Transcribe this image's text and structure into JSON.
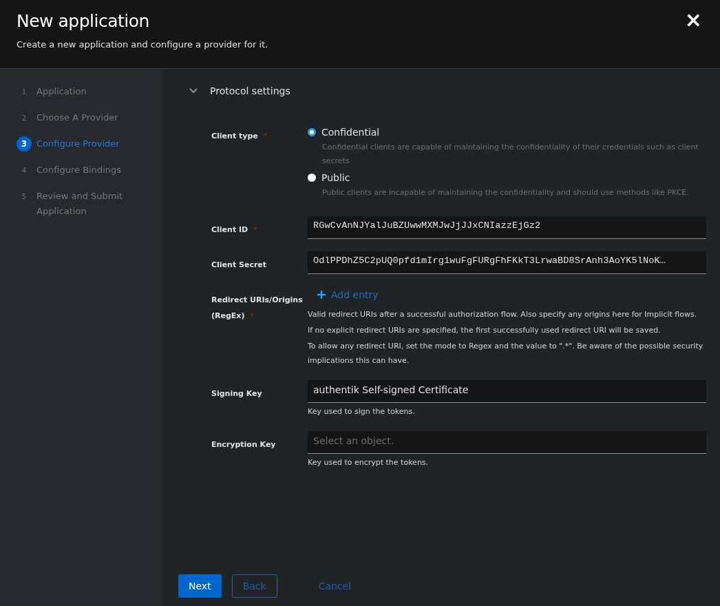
{
  "header": {
    "title": "New application",
    "subtitle": "Create a new application and configure a provider for it.",
    "close": "×"
  },
  "steps": [
    {
      "number": "1",
      "label": "Application",
      "selected": false
    },
    {
      "number": "2",
      "label": "Choose A Provider",
      "selected": false
    },
    {
      "number": "3",
      "label": "Configure Provider",
      "selected": true
    },
    {
      "number": "4",
      "label": "Configure Bindings",
      "selected": false
    },
    {
      "number": "5",
      "label": "Review and Submit Application",
      "selected": false
    }
  ],
  "section": {
    "title": "Protocol settings",
    "expanded": true
  },
  "client_type": {
    "label": "Client type",
    "required_mark": "*",
    "options": [
      {
        "label": "Confidential",
        "description": "Confidential clients are capable of maintaining the confidentiality of their credentials such as client secrets",
        "selected": true
      },
      {
        "label": "Public",
        "description": "Public clients are incapable of maintaining the confidentiality and should use methods like PKCE.",
        "selected": false
      }
    ]
  },
  "fields": [
    {
      "kind": "text",
      "label": "Client ID",
      "required_mark": "*",
      "value": "RGwCvAnNJYalJuBZUwwMXMJwJjJJxCNIazzEjGz2"
    },
    {
      "kind": "text",
      "label": "Client Secret",
      "value": "OdlPPDhZ5C2pUQ0pfd1mIrg1wuFgFURgFhFKkT3LrwaBD8SrAnh3AoYK5lNoK…"
    },
    {
      "kind": "list",
      "label": "Redirect URIs/Origins (RegEx)",
      "required_mark": "*",
      "action": "Add entry",
      "help": [
        "Valid redirect URIs after a successful authorization flow. Also specify any origins here for Implicit flows.",
        "If no explicit redirect URIs are specified, the first successfully used redirect URI will be saved.",
        "To allow any redirect URI, set the mode to Regex and the value to \".*\". Be aware of the possible security implications this can have."
      ]
    },
    {
      "kind": "select",
      "label": "Signing Key",
      "value": "authentik Self-signed Certificate",
      "help": [
        "Key used to sign the tokens."
      ]
    },
    {
      "kind": "select",
      "label": "Encryption Key",
      "placeholder": "Select an object.",
      "help": [
        "Key used to encrypt the tokens."
      ]
    }
  ],
  "buttons": {
    "next": "Next",
    "back": "Back",
    "cancel": "Cancel"
  }
}
